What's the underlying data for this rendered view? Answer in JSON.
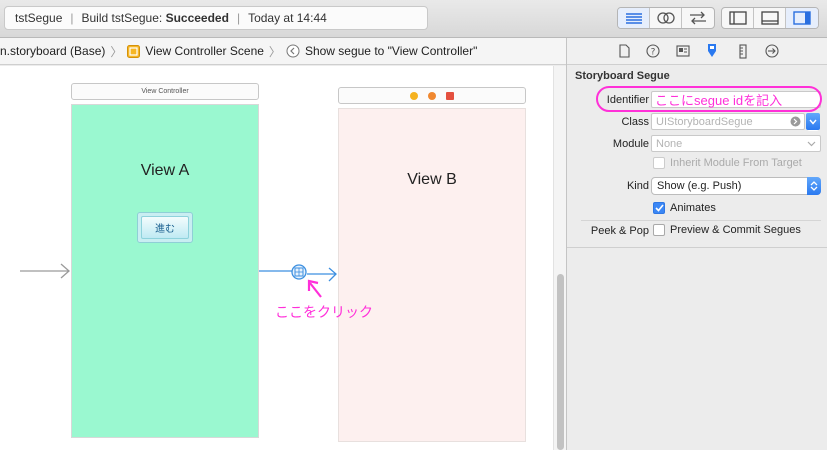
{
  "toolbar": {
    "project": "tstSegue",
    "build_prefix": "Build tstSegue:",
    "build_status": "Succeeded",
    "time": "Today at 14:44"
  },
  "jumpbar": {
    "crumb1": "n.storyboard (Base)",
    "crumb2": "View Controller Scene",
    "crumb3": "Show segue to \"View Controller\""
  },
  "canvas": {
    "scene_a_title": "View Controller",
    "view_a_label": "View A",
    "go_button": "進む",
    "view_b_label": "View B",
    "click_annotation": "ここをクリック"
  },
  "inspector": {
    "heading": "Storyboard Segue",
    "identifier_label": "Identifier",
    "identifier_annotation": "ここにsegue idを記入",
    "class_label": "Class",
    "class_placeholder": "UIStoryboardSegue",
    "module_label": "Module",
    "module_placeholder": "None",
    "inherit_label": "Inherit Module From Target",
    "kind_label": "Kind",
    "kind_value": "Show (e.g. Push)",
    "animates_label": "Animates",
    "animates_checked": true,
    "peek_label": "Peek & Pop",
    "peek_value_label": "Preview & Commit Segues",
    "peek_checked": false
  },
  "colors": {
    "view_a_bg": "#9af8d0",
    "view_b_bg": "#fdf0ef",
    "annotation": "#ff2fd9",
    "segue_line": "#3c8fe0",
    "accent": "#2a79f0"
  },
  "icons": [
    "file-icon",
    "help-icon",
    "identity-icon",
    "attributes-icon",
    "size-icon",
    "connections-icon",
    "editor-standard-icon",
    "editor-assistant-icon",
    "editor-version-icon",
    "navigator-toggle-icon",
    "debug-toggle-icon",
    "utilities-toggle-icon"
  ]
}
